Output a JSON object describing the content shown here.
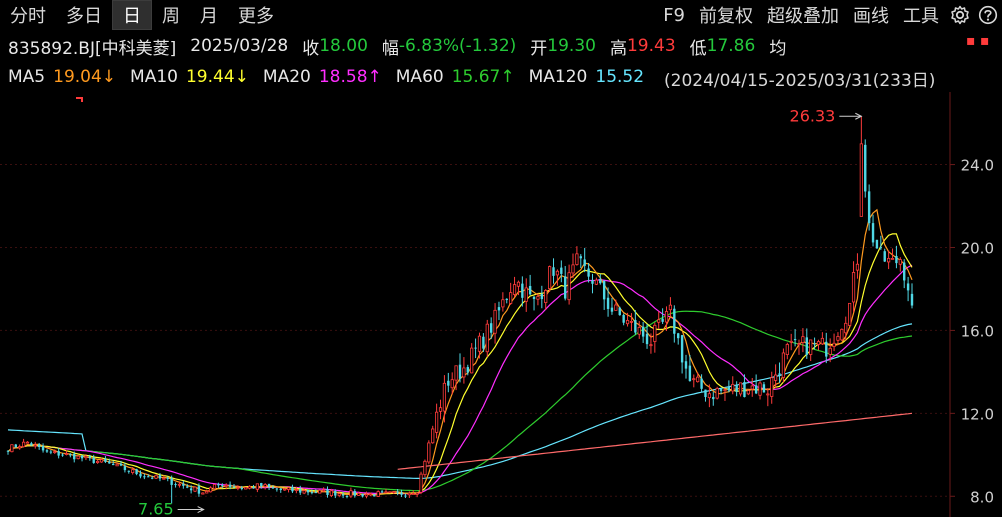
{
  "toolbar": {
    "tabs": [
      "分时",
      "多日",
      "日",
      "周",
      "月",
      "更多"
    ],
    "active_tab": "日",
    "tools": [
      "F9",
      "前复权",
      "超级叠加",
      "画线",
      "工具"
    ],
    "icons": [
      "gear-icon",
      "help-icon"
    ]
  },
  "quote": {
    "code_name": "835892.BJ[中科美菱]",
    "date": "2025/03/28",
    "close_label": "收",
    "close_value": "18.00",
    "change_label": "幅",
    "change_value": "-6.83%(-1.32)",
    "open_label": "开",
    "open_value": "19.30",
    "high_label": "高",
    "high_value": "19.43",
    "low_label": "低",
    "low_value": "17.86",
    "avg_label": "均"
  },
  "ma_row": [
    {
      "label": "MA5",
      "value": "19.04↓",
      "color": "#ff9a1f"
    },
    {
      "label": "MA10",
      "value": "19.44↓",
      "color": "#ffff2e"
    },
    {
      "label": "MA20",
      "value": "18.58↑",
      "color": "#ff2eff"
    },
    {
      "label": "MA60",
      "value": "15.67↑",
      "color": "#2ecc2e"
    },
    {
      "label": "MA120",
      "value": "15.52",
      "color": "#66e6ff"
    }
  ],
  "period_text": "(2024/04/15-2025/03/31(233日)",
  "colors": {
    "up": "#ff3b3b",
    "down": "#4fd8e6",
    "ma5": "#ff9a1f",
    "ma10": "#ffff2e",
    "ma20": "#ff2eff",
    "ma60": "#2ecc2e",
    "ma120": "#66e6ff",
    "ma250": "#ff6a6a"
  },
  "chart_data": {
    "type": "candlestick",
    "ylim": [
      7.0,
      27.5
    ],
    "yticks": [
      "24.0",
      "20.0",
      "16.0",
      "12.0",
      "8.0"
    ],
    "ytick_values": [
      24.0,
      20.0,
      16.0,
      12.0,
      8.0
    ],
    "max_annotation": "26.33",
    "min_annotation": "7.65",
    "count": 233,
    "anchors_close": [
      [
        0,
        10.3
      ],
      [
        5,
        10.6
      ],
      [
        10,
        10.1
      ],
      [
        15,
        10.0
      ],
      [
        20,
        9.8
      ],
      [
        25,
        9.6
      ],
      [
        30,
        9.3
      ],
      [
        35,
        9.0
      ],
      [
        40,
        8.8
      ],
      [
        45,
        8.5
      ],
      [
        50,
        8.2
      ],
      [
        55,
        8.6
      ],
      [
        60,
        8.4
      ],
      [
        65,
        8.5
      ],
      [
        70,
        8.3
      ],
      [
        80,
        8.2
      ],
      [
        90,
        8.1
      ],
      [
        100,
        8.1
      ],
      [
        105,
        8.3
      ],
      [
        108,
        10.5
      ],
      [
        110,
        12.0
      ],
      [
        113,
        13.6
      ],
      [
        117,
        14.2
      ],
      [
        120,
        15.0
      ],
      [
        125,
        16.5
      ],
      [
        130,
        18.5
      ],
      [
        135,
        17.3
      ],
      [
        140,
        19.0
      ],
      [
        143,
        18.0
      ],
      [
        146,
        19.2
      ],
      [
        150,
        18.5
      ],
      [
        155,
        17.0
      ],
      [
        160,
        16.2
      ],
      [
        165,
        15.5
      ],
      [
        170,
        16.8
      ],
      [
        175,
        13.5
      ],
      [
        180,
        13.0
      ],
      [
        185,
        13.1
      ],
      [
        190,
        13.3
      ],
      [
        195,
        13.2
      ],
      [
        200,
        15.0
      ],
      [
        205,
        15.3
      ],
      [
        210,
        15.2
      ],
      [
        213,
        16.1
      ],
      [
        216,
        17.2
      ],
      [
        218,
        19.5
      ],
      [
        219,
        25.0
      ],
      [
        221,
        21.0
      ],
      [
        224,
        19.5
      ],
      [
        227,
        19.2
      ],
      [
        229,
        19.5
      ],
      [
        231,
        18.2
      ],
      [
        232,
        17.2
      ]
    ],
    "ma250_start_index": 100,
    "ma250_start_value": 9.3,
    "ma250_end_value": 12.0
  }
}
